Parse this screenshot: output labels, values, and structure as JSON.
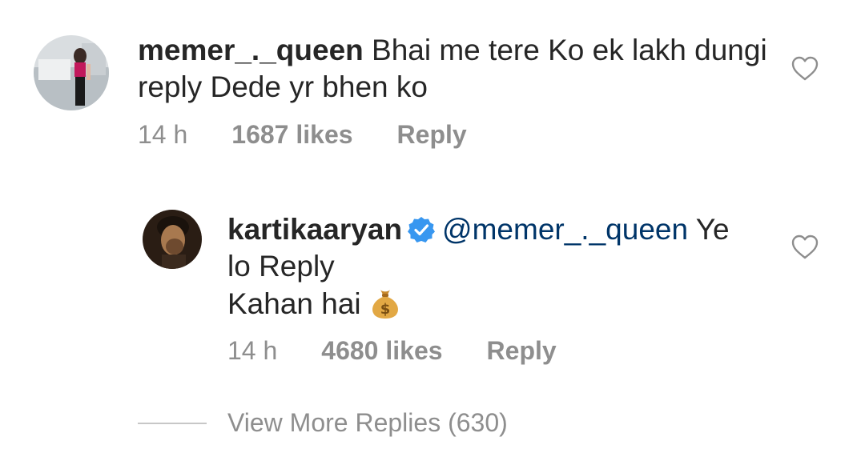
{
  "comment": {
    "username": "memer_._queen",
    "text": "Bhai me tere Ko ek lakh dungi reply Dede yr bhen ko",
    "time": "14 h",
    "likes": "1687 likes",
    "reply_label": "Reply"
  },
  "reply": {
    "username": "kartikaaryan",
    "verified": true,
    "mention": "@memer_._queen",
    "text_line1_tail": "Ye",
    "text_line2": "lo Reply",
    "text_line3": "Kahan hai",
    "emoji": "money-bag",
    "time": "14 h",
    "likes": "4680 likes",
    "reply_label": "Reply"
  },
  "view_more": {
    "label": "View More Replies (630)"
  },
  "colors": {
    "text": "#262626",
    "muted": "#8e8e8e",
    "mention": "#003569",
    "verified": "#3897f0"
  }
}
